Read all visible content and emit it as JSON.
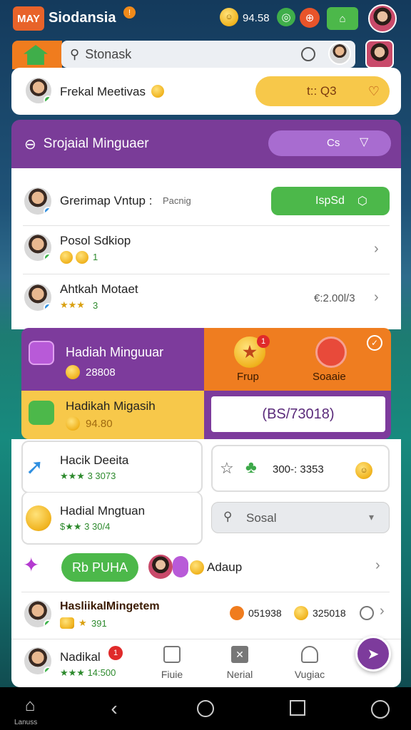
{
  "app": {
    "logo": "MAY",
    "title": "Siodansia",
    "notif": "!",
    "balance": "94.58"
  },
  "search": {
    "placeholder": "Stonask"
  },
  "profile": {
    "name": "Frekal Meetivas",
    "pill": "t:: Q3"
  },
  "section": {
    "title": "Srojaial Minguaer",
    "pill": "Cs"
  },
  "rows": [
    {
      "name": "Grerimap Vntup :",
      "sub": "Pacnig",
      "action": "IspSd"
    },
    {
      "name": "Posol Sdkiop",
      "sub": "1"
    },
    {
      "name": "Ahtkah Motaet",
      "sub": "3",
      "value": "€:2.00l/3"
    }
  ],
  "tiles": {
    "t1": {
      "title": "Hadiah Minguuar",
      "value": "28808"
    },
    "t2": {
      "a": "Frup",
      "b": "Soaaie",
      "badge": "1"
    },
    "t3": {
      "title": "Hadikah Migasih",
      "value": "94.80"
    },
    "t4": {
      "code": "(BS/73018)"
    }
  },
  "list2": [
    {
      "name": "Hacik Deeita",
      "sub": "★★★ 3 3073"
    },
    {
      "name": "Hadial Mngtuan",
      "sub": "$★★ 3 30/4"
    }
  ],
  "rbox": {
    "value": "300-: 3353"
  },
  "search2": {
    "placeholder": "Sosal"
  },
  "promo": {
    "button": "Rb PUHA",
    "label": "Adaup"
  },
  "last": {
    "name": "HasliikalMingetem",
    "sub": "391",
    "v1": "051938",
    "v2": "325018"
  },
  "tabbar": {
    "name": "Nadikal",
    "sub": "★★★ 14:500",
    "badge": "1",
    "t1": "Fiuie",
    "t2": "Nerial",
    "t3": "Vugiac"
  },
  "sysnav": {
    "home": "Lanuss"
  },
  "colors": {
    "purple": "#7a3c98",
    "orange": "#ef7d20",
    "green": "#4cb84a",
    "yellow": "#f7c84a"
  }
}
